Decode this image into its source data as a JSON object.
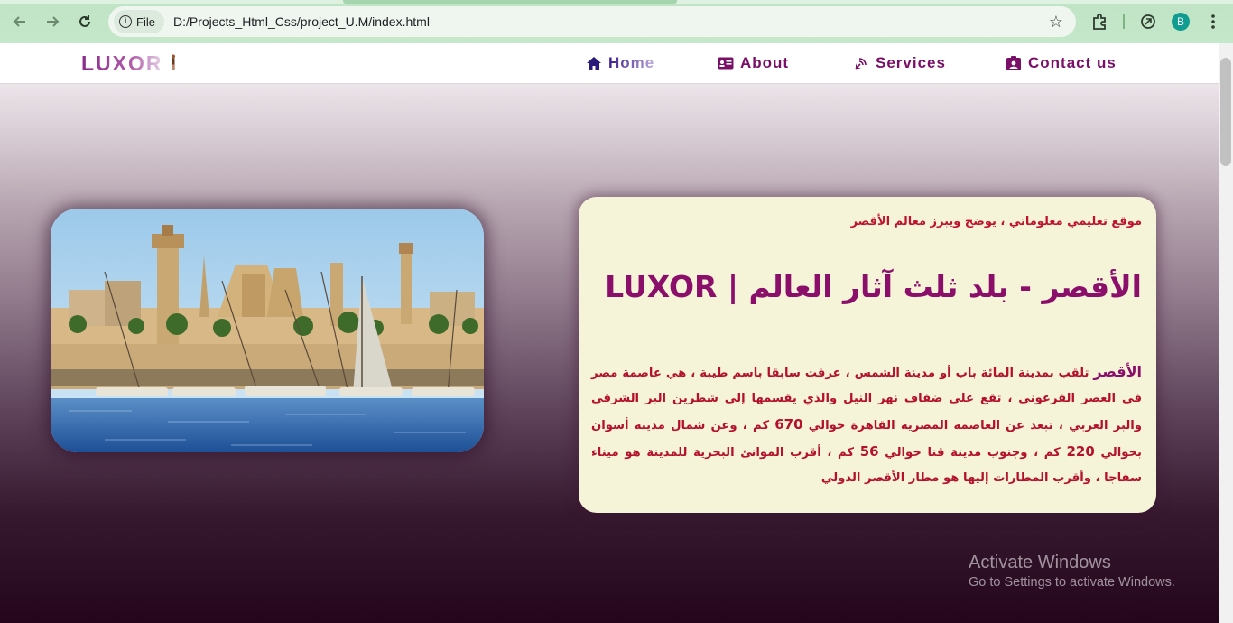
{
  "browser": {
    "file_chip": "File",
    "url": "D:/Projects_Html_Css/project_U.M/index.html",
    "profile_initial": "B",
    "icons": [
      "back-icon",
      "forward-icon",
      "reload-icon",
      "info-icon",
      "star-icon",
      "extensions-icon",
      "copilot-icon",
      "profile-avatar",
      "menu-icon"
    ]
  },
  "header": {
    "logo": "LUXOR",
    "nav": [
      {
        "label": "Home",
        "icon": "home-icon"
      },
      {
        "label": "About",
        "icon": "id-card-icon"
      },
      {
        "label": "Services",
        "icon": "satellite-dish-icon"
      },
      {
        "label": "Contact us",
        "icon": "contact-icon"
      }
    ]
  },
  "card": {
    "tagline": "موقع تعليمي معلوماتي ، يوضح ويبرز معالم الأقصر",
    "title": "الأقصر - بلد ثلث آثار العالم | LUXOR",
    "body_lead": "الأقصر",
    "body_part1": " تلقب بمدينة المائة باب أو مدينة الشمس ، عرفت سابقا باسم طيبة ، هي عاصمة مصر في العصر الفرعوني ، تقع على ضفاف نهر النيل والذي يقسمها إلى شطرين البر الشرقي والبر الغربي ، تبعد عن العاصمة المصرية  القاهرة حوالي ",
    "num1": "670",
    "body_part2": " كم ، وعن شمال مدينة أسوان بحوالي ",
    "num2": "220",
    "body_part3": " كم ، وجنوب مدينة قنا حوالي ",
    "num3": "56",
    "body_part4": " كم ، أقرب الموانئ البحرية للمدينة هو ميناء سفاجا ، وأقرب المطارات إليها هو مطار الأقصر الدولي"
  },
  "windows_watermark": {
    "line1": "Activate Windows",
    "line2": "Go to Settings to activate Windows."
  },
  "colors": {
    "accent_purple": "#8b0e6b",
    "accent_red": "#c0112f",
    "card_bg": "#f6f4d8",
    "chrome_green": "#c6e8ca"
  }
}
